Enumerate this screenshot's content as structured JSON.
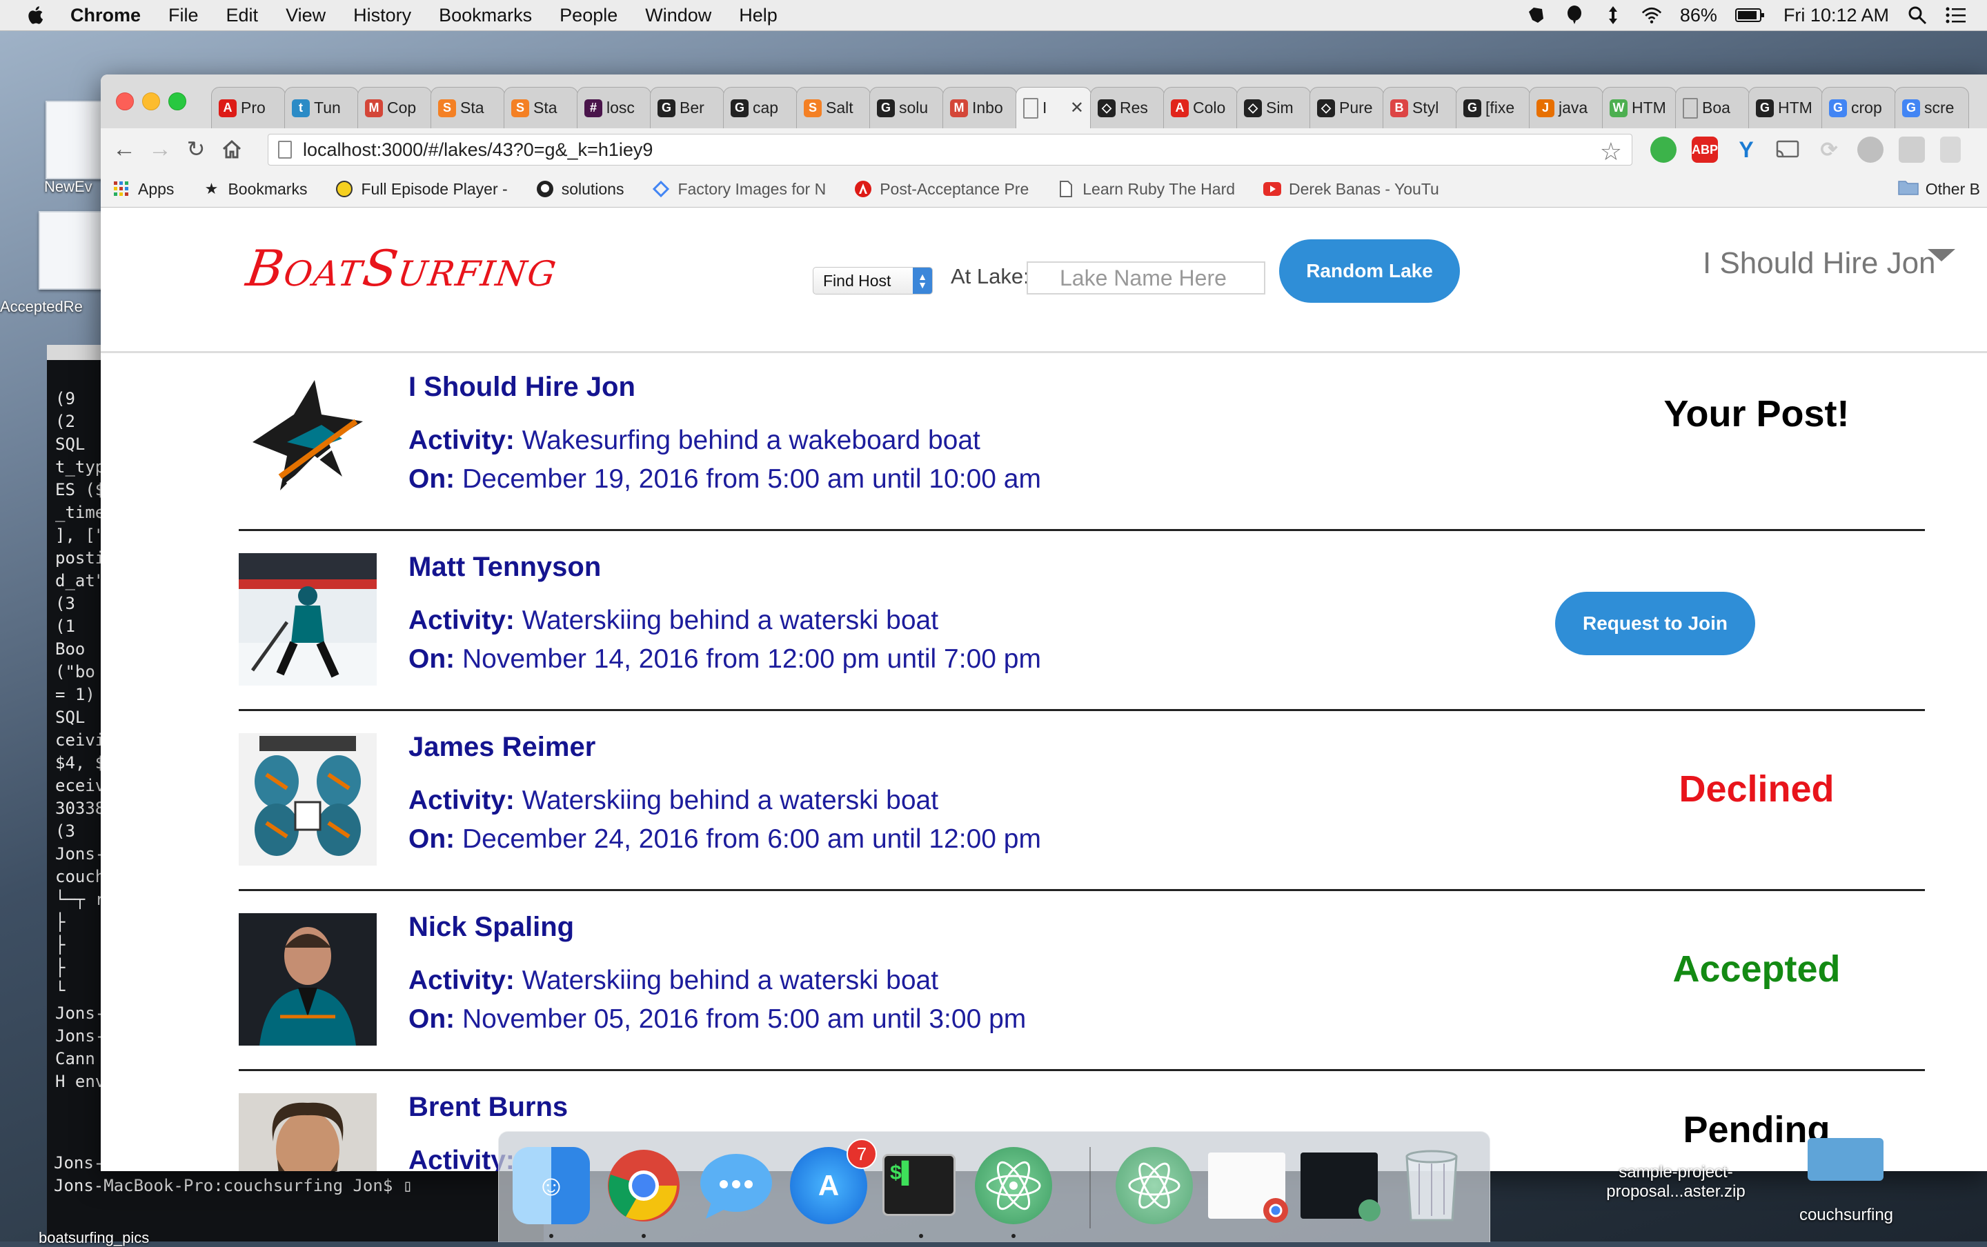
{
  "menubar": {
    "app_name": "Chrome",
    "items": [
      "File",
      "Edit",
      "View",
      "History",
      "Bookmarks",
      "People",
      "Window",
      "Help"
    ],
    "battery": "86%",
    "clock": "Fri 10:12 AM"
  },
  "browser": {
    "tabs": [
      {
        "label": "Pro",
        "icon": "angular-icon",
        "color": "#dd1b16",
        "glyph": "A"
      },
      {
        "label": "Tun",
        "icon": "bird-icon",
        "color": "#2b8bc6",
        "glyph": "t"
      },
      {
        "label": "Cop",
        "icon": "gmail-icon",
        "color": "#d44638",
        "glyph": "M"
      },
      {
        "label": "Sta",
        "icon": "stack-icon",
        "color": "#f48024",
        "glyph": "S"
      },
      {
        "label": "Sta",
        "icon": "stack-icon",
        "color": "#f48024",
        "glyph": "S"
      },
      {
        "label": "losc",
        "icon": "slack-icon",
        "color": "#4a154b",
        "glyph": "#"
      },
      {
        "label": "Ber",
        "icon": "github-icon",
        "color": "#222222",
        "glyph": "G"
      },
      {
        "label": "cap",
        "icon": "github-icon",
        "color": "#222222",
        "glyph": "G"
      },
      {
        "label": "Salt",
        "icon": "stack-icon",
        "color": "#f48024",
        "glyph": "S"
      },
      {
        "label": "solu",
        "icon": "github-icon",
        "color": "#222222",
        "glyph": "G"
      },
      {
        "label": "Inbo",
        "icon": "gmail-icon",
        "color": "#d44638",
        "glyph": "M"
      },
      {
        "label": "I",
        "icon": "page-icon",
        "color": "#9a9a9a",
        "glyph": ""
      },
      {
        "label": "Res",
        "icon": "codepen-icon",
        "color": "#222222",
        "glyph": "◇"
      },
      {
        "label": "Colo",
        "icon": "adobe-icon",
        "color": "#e1251b",
        "glyph": "A"
      },
      {
        "label": "Sim",
        "icon": "codepen-icon",
        "color": "#222222",
        "glyph": "◇"
      },
      {
        "label": "Pure",
        "icon": "codepen-icon",
        "color": "#222222",
        "glyph": "◇"
      },
      {
        "label": "Styl",
        "icon": "bootstrap-icon",
        "color": "#dd4444",
        "glyph": "B"
      },
      {
        "label": "[fixe",
        "icon": "github-icon",
        "color": "#222222",
        "glyph": "G"
      },
      {
        "label": "java",
        "icon": "java-icon",
        "color": "#e76f00",
        "glyph": "J"
      },
      {
        "label": "HTM",
        "icon": "w3-icon",
        "color": "#4caf50",
        "glyph": "W"
      },
      {
        "label": "Boa",
        "icon": "page-icon",
        "color": "#9a9a9a",
        "glyph": ""
      },
      {
        "label": "HTM",
        "icon": "github-icon",
        "color": "#222222",
        "glyph": "G"
      },
      {
        "label": "crop",
        "icon": "google-icon",
        "color": "#4285f4",
        "glyph": "G"
      },
      {
        "label": "scre",
        "icon": "google-icon",
        "color": "#4285f4",
        "glyph": "G"
      }
    ],
    "active_tab_index": 11,
    "url": "localhost:3000/#/lakes/43?0=g&_k=h1iey9",
    "bookmarks": [
      {
        "label": "Apps",
        "icon": "apps-grid-icon"
      },
      {
        "label": "Bookmarks",
        "icon": "star-icon"
      },
      {
        "label": "Full Episode Player -",
        "icon": "homer-icon"
      },
      {
        "label": "solutions",
        "icon": "github-icon"
      },
      {
        "label": "Factory Images for N",
        "icon": "google-icon"
      },
      {
        "label": "Post-Acceptance Pre",
        "icon": "angular-icon"
      },
      {
        "label": "Learn Ruby The Hard",
        "icon": "page-icon"
      },
      {
        "label": "Derek Banas - YouTu",
        "icon": "youtube-icon"
      }
    ],
    "other_bookmarks": "Other B"
  },
  "site": {
    "logo": "BoatSurfing",
    "find_select": "Find Host",
    "at_lake_label": "At Lake:",
    "lake_placeholder": "Lake Name Here",
    "random_button": "Random Lake",
    "user_name": "I Should Hire Jon",
    "activity_label": "Activity:",
    "on_label": "On:",
    "posts": [
      {
        "name": "I Should Hire Jon",
        "activity": "Wakesurfing behind a wakeboard boat",
        "when": "December 19, 2016 from 5:00 am until 10:00 am",
        "status": "Your Post!",
        "status_color": "#14148f",
        "thumb": "shark-logo-icon"
      },
      {
        "name": "Matt Tennyson",
        "activity": "Waterskiing behind a waterski boat",
        "when": "November 14, 2016 from 12:00 pm until 7:00 pm",
        "button": "Request to Join",
        "thumb": "hockey-player-photo"
      },
      {
        "name": "James Reimer",
        "activity": "Waterskiing behind a waterski boat",
        "when": "December 24, 2016 from 6:00 am until 12:00 pm",
        "status": "Declined",
        "status_color": "#e8141b",
        "thumb": "goalie-masks-photo"
      },
      {
        "name": "Nick Spaling",
        "activity": "Waterskiing behind a waterski boat",
        "when": "November 05, 2016 from 5:00 am until 3:00 pm",
        "status": "Accepted",
        "status_color": "#138a13",
        "thumb": "player-portrait-photo"
      },
      {
        "name": "Brent Burns",
        "activity": "",
        "when": "",
        "status": "Pending",
        "status_color": "#14148f",
        "thumb": "bearded-player-photo"
      }
    ]
  },
  "desktop": {
    "icon_labels": [
      "NewEv",
      "AcceptedRe"
    ],
    "file_label_1": "sample-project-",
    "file_label_2": "proposal...aster.zip",
    "folder_label": "couchsurfing",
    "bottom_label": "boatsurfing_pics"
  },
  "terminal": {
    "lines": [
      "(9",
      "(2",
      "SQL",
      "t_typ",
      "ES ($",
      "_time",
      "], [\"",
      "posti",
      "d_at\"",
      "(3",
      "(1",
      "Boo",
      "(\"bo",
      "= 1)",
      "SQL",
      "ceivi",
      "$4, $",
      "eceiv",
      "30338",
      "(3",
      "Jons-",
      "couch",
      "└─┬ r",
      "├",
      "├",
      "├",
      "└",
      "",
      "Jons-",
      "Jons-",
      "Cann",
      "H env"
    ],
    "prompt_1": "Jons-MacBook-Pro:couchsurfing Jon$ atom .",
    "prompt_2": "Jons-MacBook-Pro:couchsurfing Jon$"
  },
  "dock": {
    "apps": [
      {
        "name": "finder-icon",
        "color": "#3d9bf0"
      },
      {
        "name": "chrome-icon",
        "color": "#e8e8e8"
      },
      {
        "name": "messages-icon",
        "color": "#5ab0f5"
      },
      {
        "name": "app-store-icon",
        "color": "#1d8ff0"
      },
      {
        "name": "terminal-icon",
        "color": "#1e1e1e"
      },
      {
        "name": "atom-icon",
        "color": "#5fb57d"
      }
    ],
    "app_store_badge": "7"
  }
}
